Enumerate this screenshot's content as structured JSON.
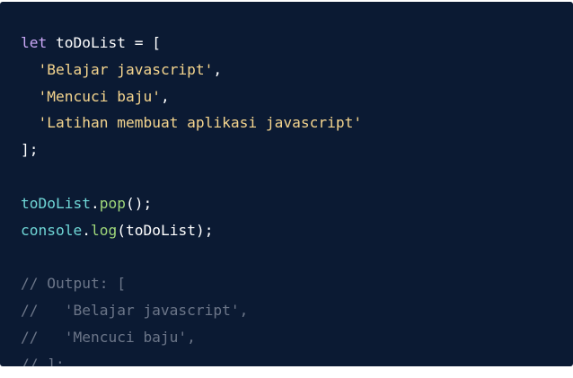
{
  "code": {
    "line1": {
      "kw": "let",
      "name": "toDoList",
      "rest": " = ["
    },
    "line2": {
      "indent": "  ",
      "str": "'Belajar javascript'",
      "punc": ","
    },
    "line3": {
      "indent": "  ",
      "str": "'Mencuci baju'",
      "punc": ","
    },
    "line4": {
      "indent": "  ",
      "str": "'Latihan membuat aplikasi javascript'"
    },
    "line5": {
      "punc": "];"
    },
    "line7": {
      "obj": "toDoList",
      "dot": ".",
      "method": "pop",
      "rest": "();"
    },
    "line8": {
      "obj": "console",
      "dot": ".",
      "method": "log",
      "rest": "(toDoList);"
    },
    "comment1": "// Output: [",
    "comment2": "//   'Belajar javascript',",
    "comment3": "//   'Mencuci baju',",
    "comment4": "// ];"
  },
  "colors": {
    "background": "#0b1a33",
    "keyword": "#c9a7f5",
    "string": "#f5d58e",
    "object": "#6fd6d6",
    "method": "#9fd77a",
    "comment": "#6b7588"
  }
}
